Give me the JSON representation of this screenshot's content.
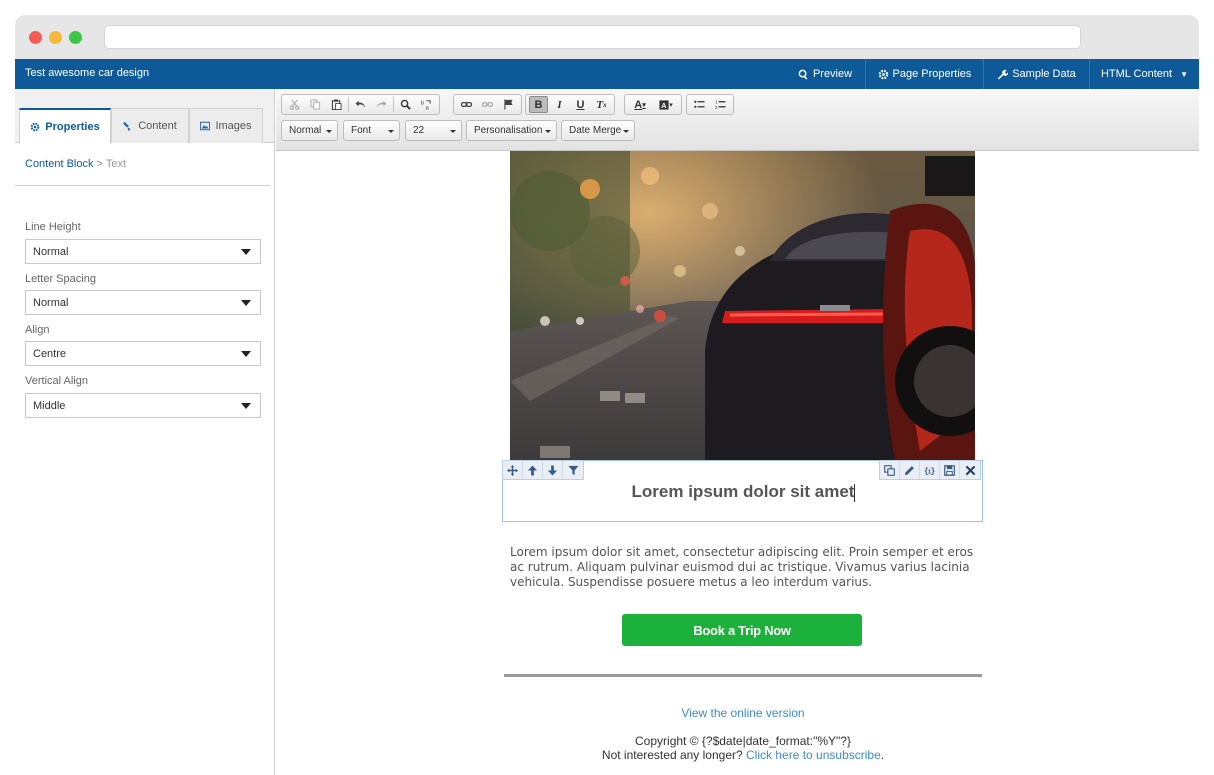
{
  "app": {
    "title": "Test awesome car design",
    "header_buttons": [
      {
        "label": "Preview",
        "icon": "search-icon"
      },
      {
        "label": "Page Properties",
        "icon": "gear-icon"
      },
      {
        "label": "Sample Data",
        "icon": "wrench-icon"
      },
      {
        "label": "HTML Content",
        "icon": "caret-down-icon"
      }
    ]
  },
  "left_panel": {
    "tabs": [
      {
        "label": "Properties",
        "icon": "gear-icon",
        "active": true
      },
      {
        "label": "Content",
        "icon": "paint-icon",
        "active": false
      },
      {
        "label": "Images",
        "icon": "image-icon",
        "active": false
      }
    ],
    "breadcrumb": {
      "root": "Content Block",
      "separator": ">",
      "current": "Text"
    },
    "properties": [
      {
        "label": "Line Height",
        "value": "Normal"
      },
      {
        "label": "Letter Spacing",
        "value": "Normal"
      },
      {
        "label": "Align",
        "value": "Centre"
      },
      {
        "label": "Vertical Align",
        "value": "Middle"
      }
    ]
  },
  "toolbar": {
    "combos": [
      {
        "label": "Normal"
      },
      {
        "label": "Font"
      },
      {
        "label": "22"
      },
      {
        "label": "Personalisation"
      },
      {
        "label": "Date Merge"
      }
    ],
    "bold_active": true
  },
  "email": {
    "headline": "Lorem ipsum dolor sit amet",
    "body": "Lorem ipsum dolor sit amet, consectetur adipiscing elit. Proin semper et eros ac rutrum. Aliquam pulvinar euismod dui ac tristique. Vivamus varius lacinia vehicula. Suspendisse posuere metus a leo interdum varius.",
    "cta_label": "Book a Trip Now",
    "footer_link": "View the online version",
    "copyright": "Copyright © {?$date|date_format:\"%Y\"?}",
    "unsub_prefix": "Not interested any longer?",
    "unsub_link": "Click here to unsubscribe",
    "unsub_suffix": "."
  },
  "colors": {
    "brand": "#0e5a99",
    "cta": "#1bb13a",
    "link": "#3f8ac7"
  }
}
